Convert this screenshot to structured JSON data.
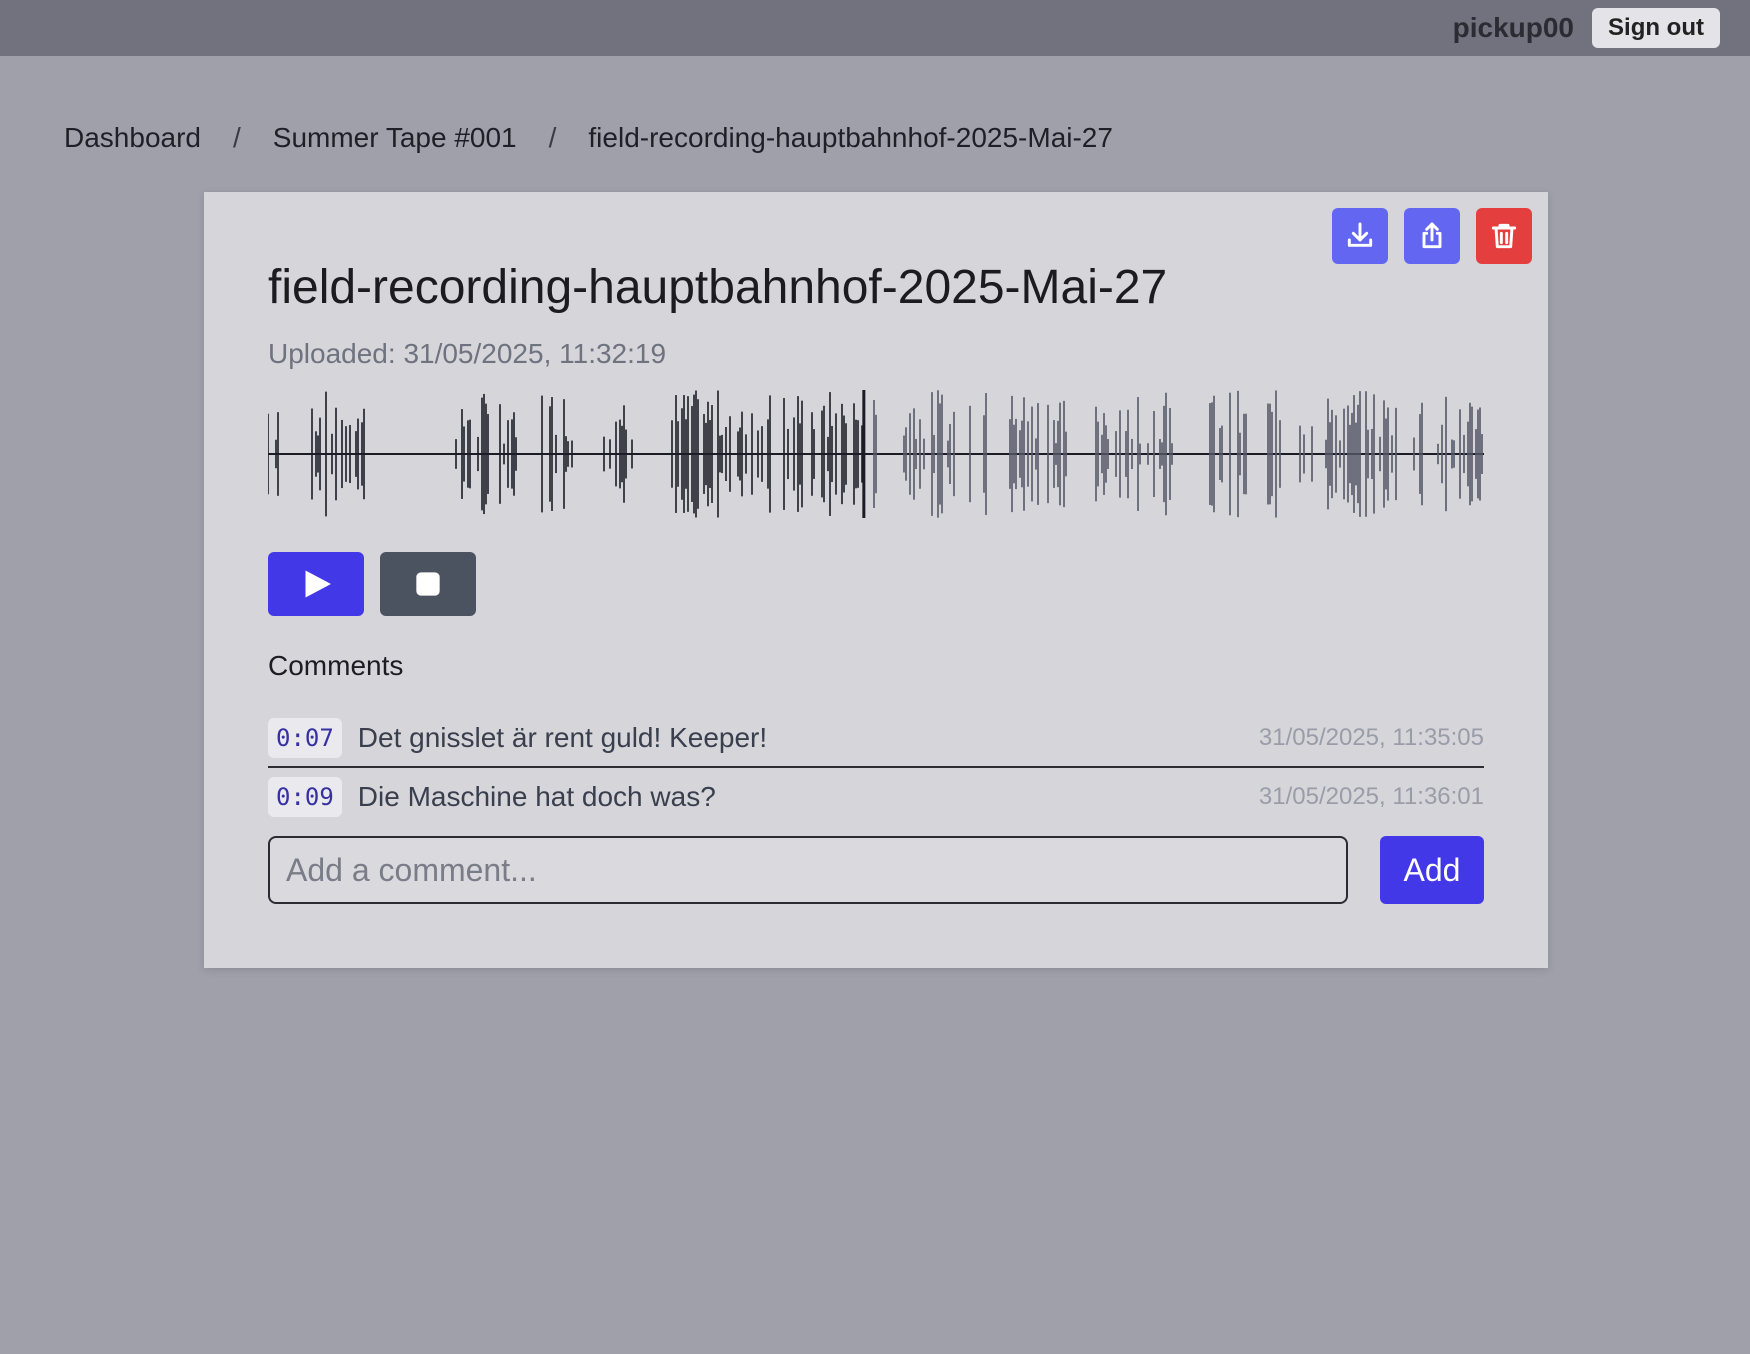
{
  "header": {
    "username": "pickup00",
    "sign_out_label": "Sign out"
  },
  "breadcrumb": {
    "items": [
      "Dashboard",
      "Summer Tape #001",
      "field-recording-hauptbahnhof-2025-Mai-27"
    ],
    "separator": "/"
  },
  "track": {
    "title": "field-recording-hauptbahnhof-2025-Mai-27",
    "uploaded_label": "Uploaded:",
    "uploaded_value": "31/05/2025, 11:32:19",
    "actions": {
      "download_icon": "download-icon",
      "share_icon": "share-icon",
      "delete_icon": "trash-icon"
    },
    "colors": {
      "accent": "#4338e8",
      "action_blue": "#6366f1",
      "danger": "#e53e3e",
      "waveform_played": "#1c1c26",
      "waveform_unplayed": "#565868"
    },
    "playback_progress": 0.49
  },
  "player": {
    "play_icon": "play-icon",
    "stop_icon": "stop-icon"
  },
  "comments": {
    "heading": "Comments",
    "items": [
      {
        "timecode": "0:07",
        "text": "Det gnisslet är rent guld! Keeper!",
        "timestamp": "31/05/2025, 11:35:05"
      },
      {
        "timecode": "0:09",
        "text": "Die Maschine hat doch was?",
        "timestamp": "31/05/2025, 11:36:01"
      }
    ],
    "input_placeholder": "Add a comment...",
    "add_label": "Add"
  }
}
